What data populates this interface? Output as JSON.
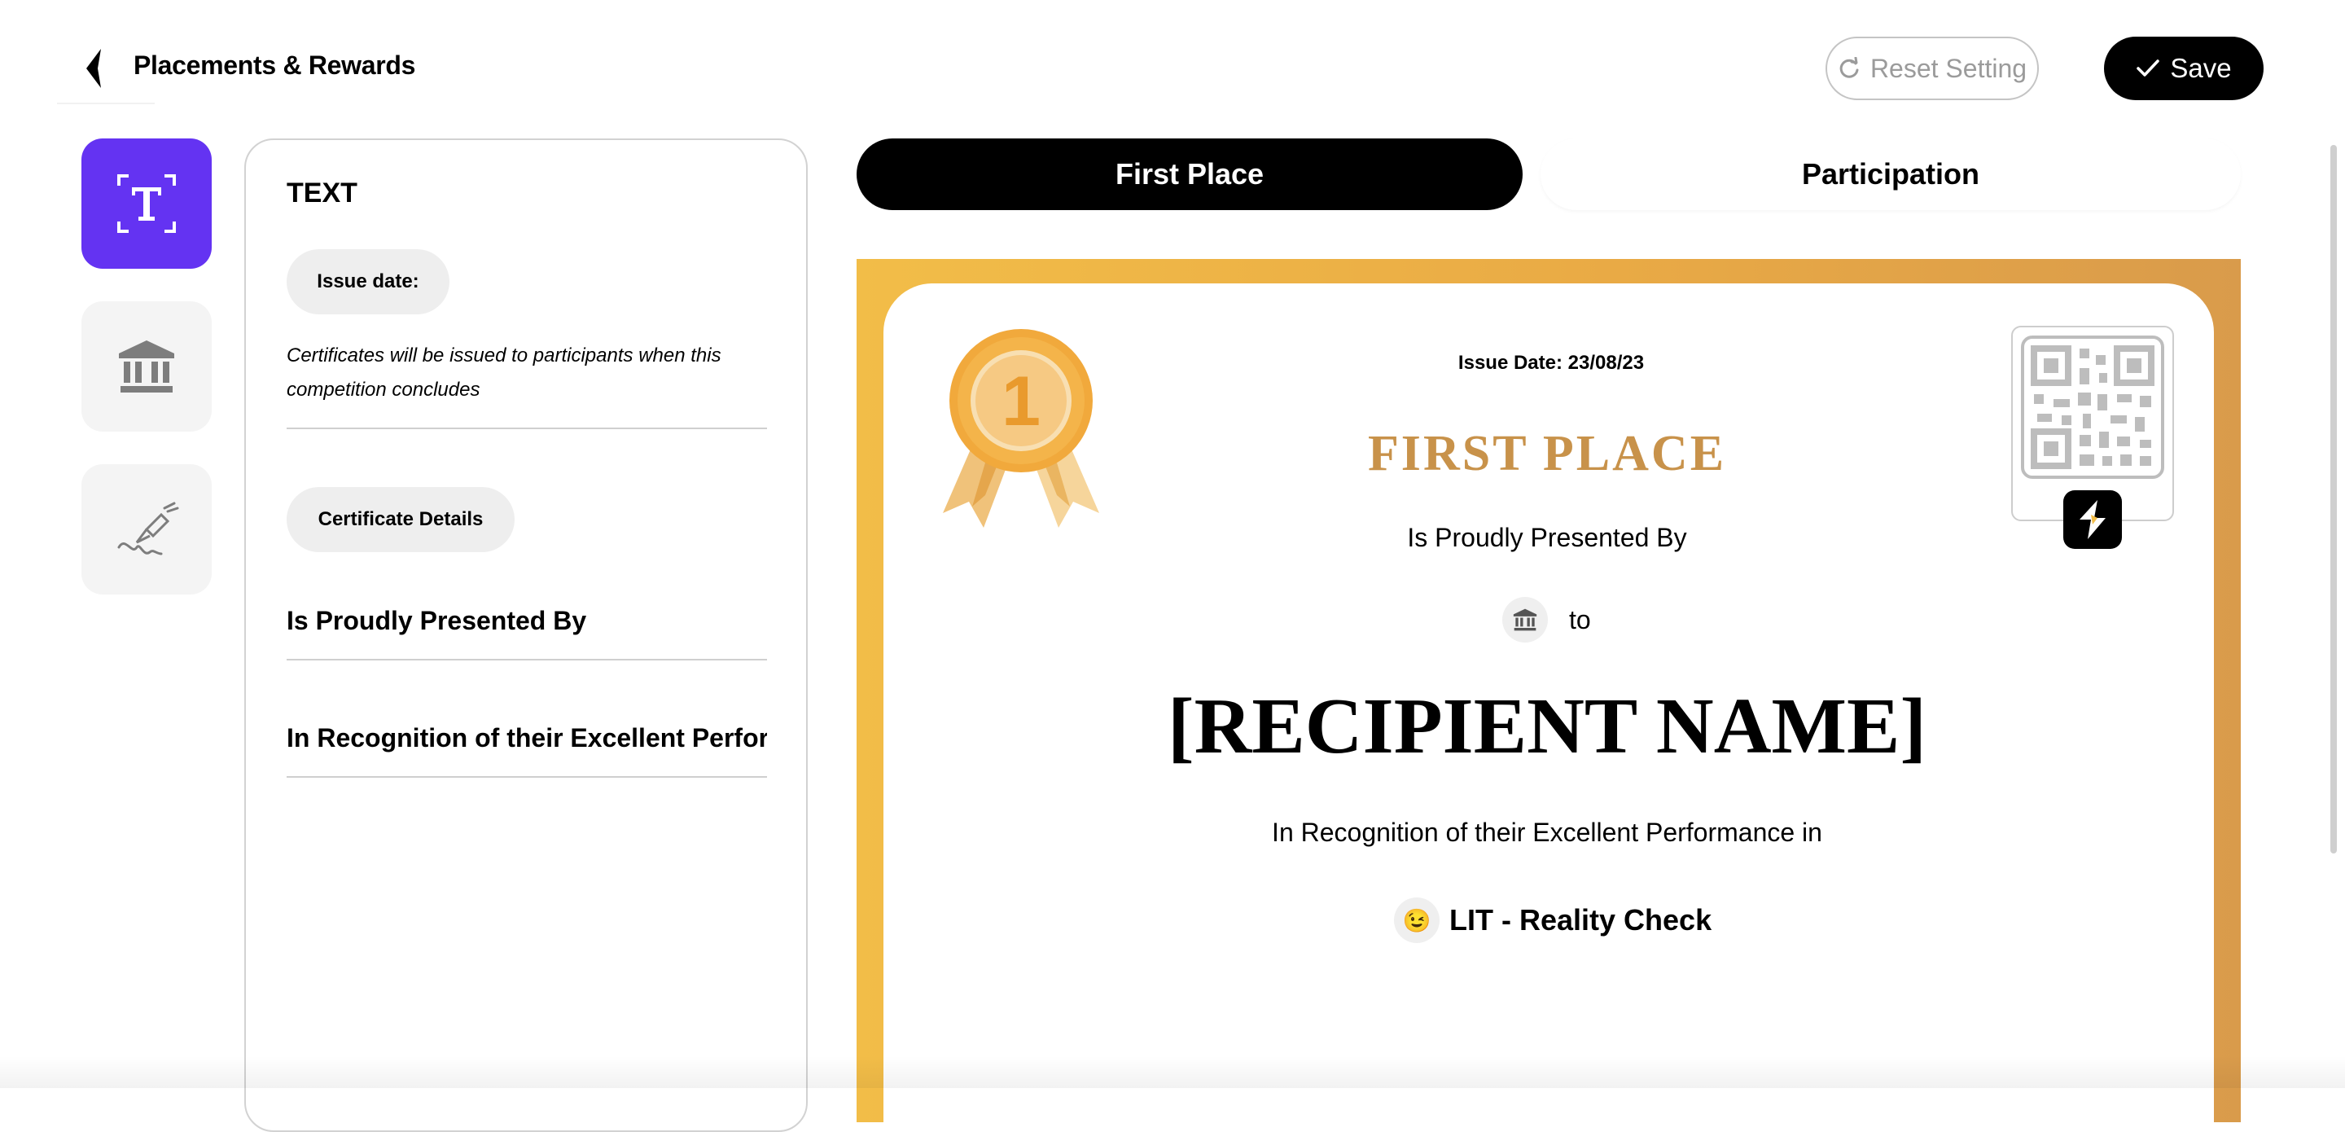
{
  "header": {
    "title": "Placements & Rewards",
    "reset_label": "Reset Setting",
    "save_label": "Save"
  },
  "tools": [
    "text-tool",
    "institution-tool",
    "signature-tool"
  ],
  "editor": {
    "section_title": "TEXT",
    "issue_date_label": "Issue date:",
    "issue_note": "Certificates will be issued to participants when this competition concludes",
    "details_label": "Certificate Details",
    "presented_by_value": "Is Proudly Presented By",
    "recognition_value": "In Recognition of their Excellent Performance in"
  },
  "tabs": [
    "First Place",
    "Participation"
  ],
  "certificate": {
    "issue_date": "Issue Date: 23/08/23",
    "title": "FIRST PLACE",
    "presented_by": "Is Proudly Presented By",
    "to_text": "to",
    "recipient": "[RECIPIENT NAME]",
    "recognition": "In Recognition of their Excellent Performance in",
    "competition_emoji": "😉",
    "competition": "LIT - Reality Check",
    "medal_number": "1"
  },
  "colors": {
    "accent_purple": "#6433f2",
    "gold_start": "#f2bd48",
    "gold_end": "#d99b4b",
    "title_gold": "#c8924a"
  }
}
